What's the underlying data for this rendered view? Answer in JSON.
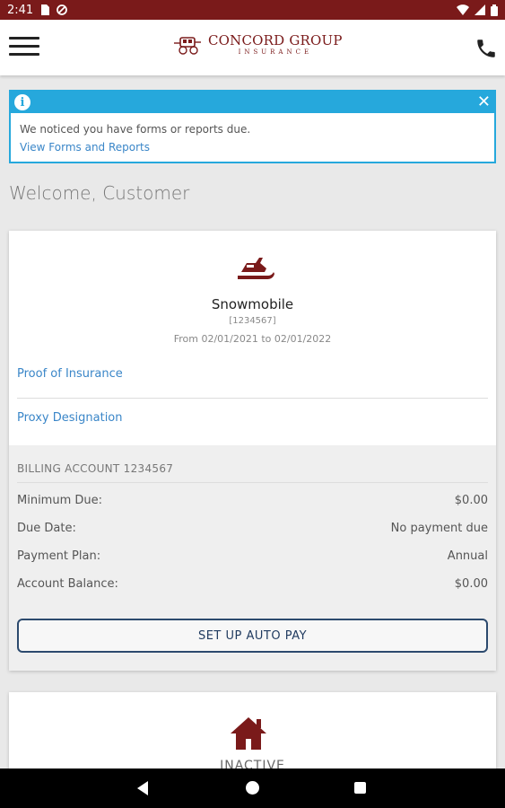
{
  "status_bar": {
    "time": "2:41"
  },
  "app_bar": {
    "logo_main": "CONCORD GROUP",
    "logo_sub": "INSURANCE"
  },
  "alert": {
    "message": "We noticed you have forms or reports due.",
    "link": "View Forms and Reports"
  },
  "welcome": "Welcome, Customer",
  "policy": {
    "icon": "snowmobile-icon",
    "name": "Snowmobile",
    "number": "[1234567]",
    "dates": "From 02/01/2021 to 02/01/2022",
    "links": [
      "Proof of Insurance",
      "Proxy Designation"
    ]
  },
  "billing": {
    "title": "BILLING ACCOUNT 1234567",
    "rows": [
      {
        "label": "Minimum Due:",
        "value": "$0.00"
      },
      {
        "label": "Due Date:",
        "value": "No payment due"
      },
      {
        "label": "Payment Plan:",
        "value": "Annual"
      },
      {
        "label": "Account Balance:",
        "value": "$0.00"
      }
    ],
    "autopay_label": "SET UP AUTO PAY"
  },
  "card2": {
    "icon": "house-icon",
    "status": "INACTIVE"
  },
  "colors": {
    "brand": "#7a1a1a",
    "info": "#26a8dc",
    "link": "#3a86c8",
    "button": "#2c4a6e"
  }
}
